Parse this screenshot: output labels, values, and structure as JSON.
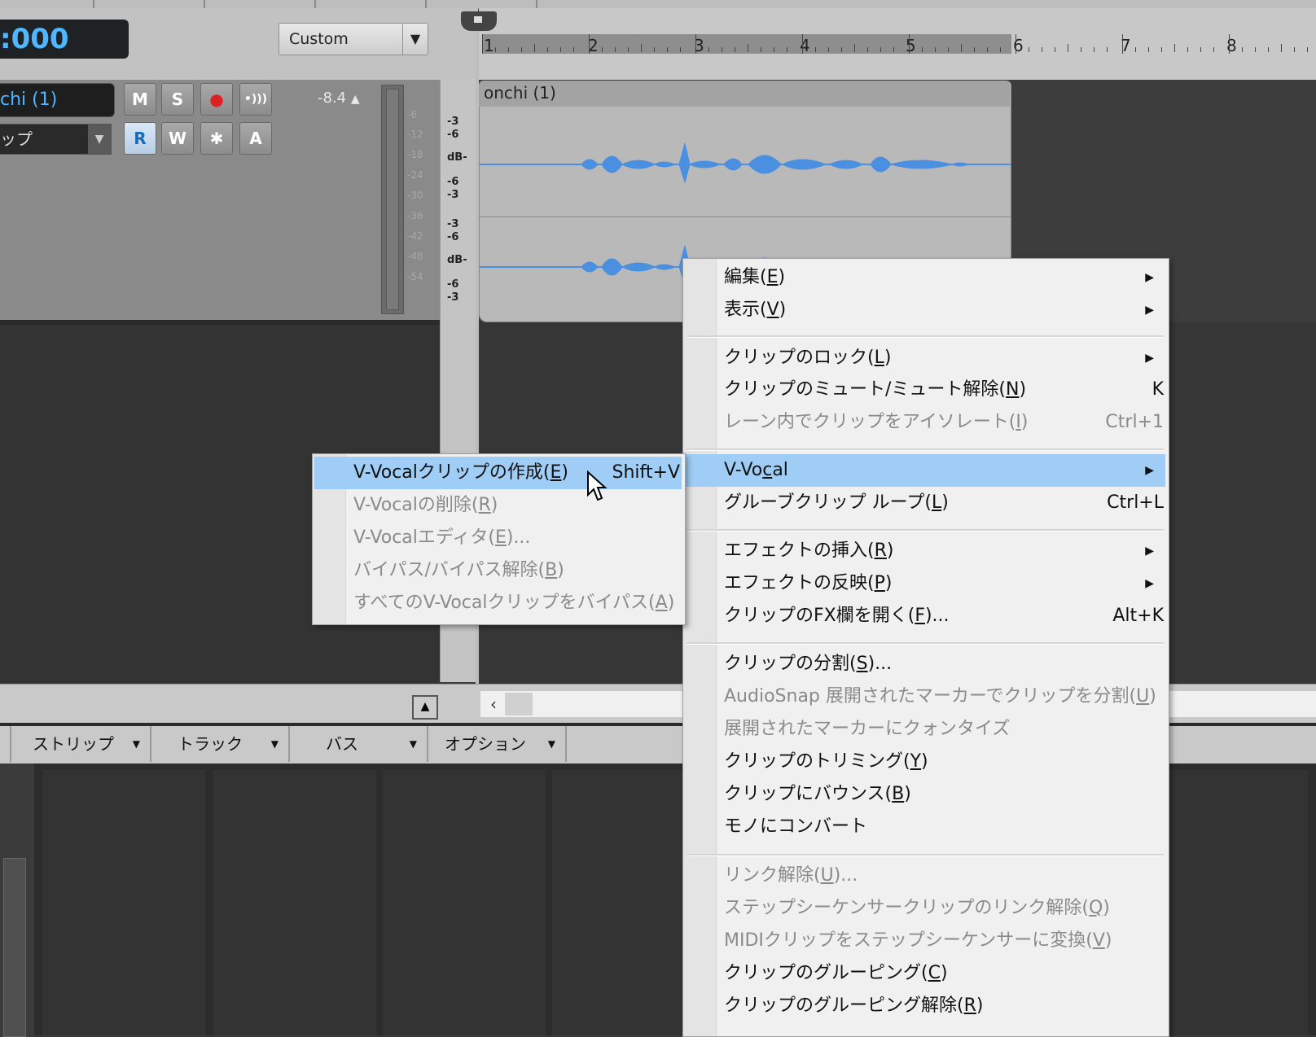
{
  "transport": {
    "time_display": ":000",
    "layout_dropdown": "Custom"
  },
  "track": {
    "name": "chi (1)",
    "input_label": "ップ",
    "buttons": {
      "mute": "M",
      "solo": "S",
      "rec": "●",
      "echo": "•)))",
      "read": "R",
      "write": "W",
      "freeze": "✱",
      "auto": "A"
    },
    "volume": "-8.4",
    "meter_labels": [
      "-6",
      "-12",
      "-18",
      "-24",
      "-30",
      "-36",
      "-42",
      "-48",
      "-54"
    ]
  },
  "scale_labels": {
    "top": [
      "-3",
      "-6",
      "dB-",
      "-6",
      "-3"
    ],
    "bottom": [
      "-3",
      "-6",
      "dB-",
      "-6",
      "-3"
    ]
  },
  "ruler": {
    "bars": [
      "1",
      "2",
      "3",
      "4",
      "5",
      "6",
      "7",
      "8"
    ]
  },
  "clip": {
    "name": "onchi (1)"
  },
  "console_tabs": [
    "ストリップ",
    "トラック",
    "バス",
    "オプション"
  ],
  "context_menu": {
    "items": [
      {
        "label": "編集(",
        "acc": "E",
        "tail": ")",
        "submenu": true
      },
      {
        "label": "表示(",
        "acc": "V",
        "tail": ")",
        "submenu": true
      },
      {
        "label": "クリップのロック(",
        "acc": "L",
        "tail": ")",
        "submenu": true
      },
      {
        "label": "クリップのミュート/ミュート解除(",
        "acc": "N",
        "tail": ")",
        "shortcut": "K"
      },
      {
        "label": "レーン内でクリップをアイソレート(",
        "acc": "I",
        "tail": ")",
        "shortcut": "Ctrl+1",
        "disabled": true
      },
      {
        "label": "V-Vo",
        "acc": "c",
        "tail": "al",
        "submenu": true,
        "highlighted": true
      },
      {
        "label": "グルーブクリップ ループ(",
        "acc": "L",
        "tail": ")",
        "shortcut": "Ctrl+L"
      },
      {
        "label": "エフェクトの挿入(",
        "acc": "R",
        "tail": ")",
        "submenu": true
      },
      {
        "label": "エフェクトの反映(",
        "acc": "P",
        "tail": ")",
        "submenu": true
      },
      {
        "label": "クリップのFX欄を開く(",
        "acc": "F",
        "tail": ")...",
        "shortcut": "Alt+K"
      },
      {
        "label": "クリップの分割(",
        "acc": "S",
        "tail": ")..."
      },
      {
        "label": "AudioSnap 展開されたマーカーでクリップを分割(",
        "acc": "U",
        "tail": ")",
        "disabled": true
      },
      {
        "label": "展開されたマーカーにクォンタイズ",
        "acc": "",
        "tail": "",
        "disabled": true
      },
      {
        "label": "クリップのトリミング(",
        "acc": "Y",
        "tail": ")"
      },
      {
        "label": "クリップにバウンス(",
        "acc": "B",
        "tail": ")"
      },
      {
        "label": "モノにコンバート",
        "acc": "",
        "tail": ""
      },
      {
        "label": "リンク解除(",
        "acc": "U",
        "tail": ")...",
        "disabled": true
      },
      {
        "label": "ステップシーケンサークリップのリンク解除(",
        "acc": "Q",
        "tail": ")",
        "disabled": true
      },
      {
        "label": "MIDIクリップをステップシーケンサーに変換(",
        "acc": "V",
        "tail": ")",
        "disabled": true
      },
      {
        "label": "クリップのグルーピング(",
        "acc": "C",
        "tail": ")"
      },
      {
        "label": "クリップのグルーピング解除(",
        "acc": "R",
        "tail": ")"
      }
    ]
  },
  "vvocal_submenu": {
    "items": [
      {
        "label": "V-Vocalクリップの作成(",
        "acc": "E",
        "tail": ")",
        "shortcut": "Shift+V",
        "highlighted": true
      },
      {
        "label": "V-Vocalの削除(",
        "acc": "R",
        "tail": ")",
        "disabled": true
      },
      {
        "label": "V-Vocalエディタ(",
        "acc": "E",
        "tail": ")...",
        "disabled": true
      },
      {
        "label": "バイパス/バイパス解除(",
        "acc": "B",
        "tail": ")",
        "disabled": true
      },
      {
        "label": "すべてのV-Vocalクリップをバイパス(",
        "acc": "A",
        "tail": ")",
        "disabled": true
      }
    ]
  },
  "colors": {
    "accent_blue": "#4fb6ff",
    "menu_highlight": "#9fcdf5",
    "waveform": "#4a8fe0"
  }
}
